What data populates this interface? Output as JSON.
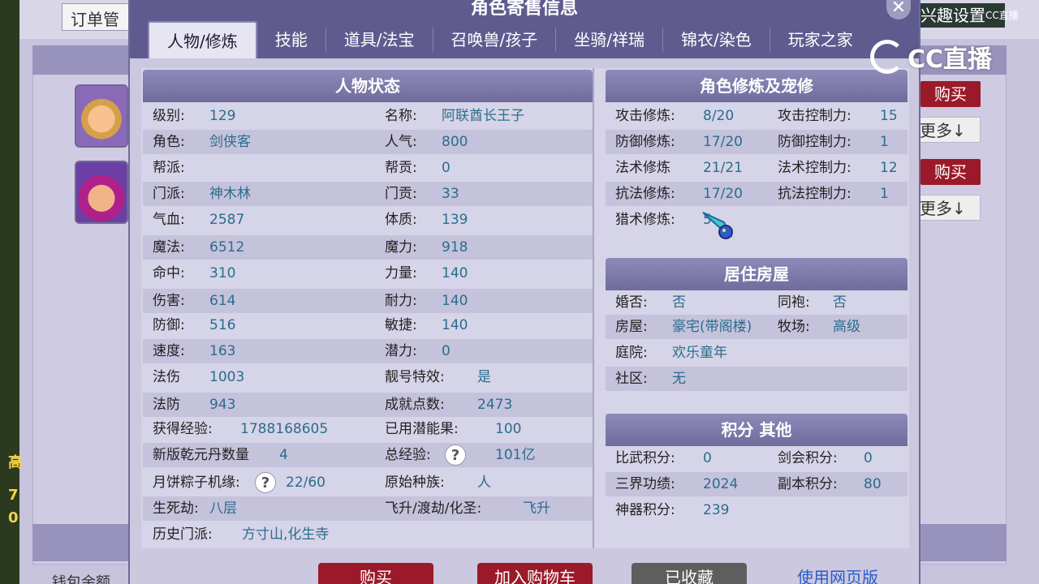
{
  "background": {
    "order_field": "订单管",
    "interest": "兴趣设置",
    "buy_label": "购买",
    "more_label": "更多↓",
    "balance": "钱包余额",
    "left_glyphs": [
      "高",
      "7",
      "0"
    ]
  },
  "watermark": {
    "brand": "CC直播",
    "small": "CC直播"
  },
  "dialog": {
    "title": "角色寄售信息",
    "close": "✕",
    "tabs": [
      "人物/修炼",
      "技能",
      "道具/法宝",
      "召唤兽/孩子",
      "坐骑/祥瑞",
      "锦衣/染色",
      "玩家之家"
    ],
    "active_tab": 0
  },
  "status": {
    "header": "人物状态",
    "left": [
      {
        "label": "级别:",
        "value": "129"
      },
      {
        "label": "角色:",
        "value": "剑侠客"
      },
      {
        "label": "帮派:",
        "value": ""
      },
      {
        "label": "门派:",
        "value": "神木林"
      },
      {
        "label": "气血:",
        "value": "2587"
      },
      {
        "label": "魔法:",
        "value": "6512"
      },
      {
        "label": "命中:",
        "value": "310"
      },
      {
        "label": "伤害:",
        "value": "614"
      },
      {
        "label": "防御:",
        "value": "516"
      },
      {
        "label": "速度:",
        "value": "163"
      },
      {
        "label": "法伤",
        "value": "1003"
      },
      {
        "label": "法防",
        "value": "943"
      },
      {
        "label": "获得经验:",
        "value": "1788168605"
      },
      {
        "label": "新版乾元丹数量",
        "value": "4"
      },
      {
        "label": "月饼粽子机缘:",
        "value": "22/60",
        "help": "?"
      },
      {
        "label": "生死劫:",
        "value": "八层"
      },
      {
        "label": "历史门派:",
        "value": "方寸山,化生寺"
      }
    ],
    "right": [
      {
        "label": "名称:",
        "value": "阿联酋长王子"
      },
      {
        "label": "人气:",
        "value": "800"
      },
      {
        "label": "帮贡:",
        "value": "0"
      },
      {
        "label": "门贡:",
        "value": "33"
      },
      {
        "label": "体质:",
        "value": "139"
      },
      {
        "label": "魔力:",
        "value": "918"
      },
      {
        "label": "力量:",
        "value": "140"
      },
      {
        "label": "耐力:",
        "value": "140"
      },
      {
        "label": "敏捷:",
        "value": "140"
      },
      {
        "label": "潜力:",
        "value": "0"
      },
      {
        "label": "靓号特效:",
        "value": "是"
      },
      {
        "label": "成就点数:",
        "value": "2473"
      },
      {
        "label": "已用潜能果:",
        "value": "100"
      },
      {
        "label": "总经验:",
        "value": "101亿",
        "help": "?"
      },
      {
        "label": "原始种族:",
        "value": "人"
      },
      {
        "label": "飞升/渡劫/化圣:",
        "value": "飞升"
      }
    ]
  },
  "cultivation": {
    "header": "角色修炼及宠修",
    "rows": [
      {
        "l1": "攻击修炼:",
        "v1": "8/20",
        "l2": "攻击控制力:",
        "v2": "15"
      },
      {
        "l1": "防御修炼:",
        "v1": "17/20",
        "l2": "防御控制力:",
        "v2": "1"
      },
      {
        "l1": "法术修炼",
        "v1": "21/21",
        "l2": "法术控制力:",
        "v2": "12"
      },
      {
        "l1": "抗法修炼:",
        "v1": "17/20",
        "l2": "抗法控制力:",
        "v2": "1"
      },
      {
        "l1": "猎术修炼:",
        "v1": "5",
        "l2": "",
        "v2": ""
      }
    ]
  },
  "house": {
    "header": "居住房屋",
    "rows": [
      {
        "l1": "婚否:",
        "v1": "否",
        "l2": "同袍:",
        "v2": "否"
      },
      {
        "l1": "房屋:",
        "v1": "豪宅(带阁楼)",
        "l2": "牧场:",
        "v2": "高级"
      },
      {
        "l1": "庭院:",
        "v1": "欢乐童年",
        "l2": "",
        "v2": ""
      },
      {
        "l1": "社区:",
        "v1": "无",
        "l2": "",
        "v2": ""
      }
    ]
  },
  "points": {
    "header": "积分 其他",
    "rows": [
      {
        "l1": "比武积分:",
        "v1": "0",
        "l2": "剑会积分:",
        "v2": "0"
      },
      {
        "l1": "三界功绩:",
        "v1": "2024",
        "l2": "副本积分:",
        "v2": "80"
      },
      {
        "l1": "神器积分:",
        "v1": "239",
        "l2": "",
        "v2": ""
      }
    ]
  },
  "footer": {
    "buy": "购买",
    "add_cart": "加入购物车",
    "favorited": "已收藏",
    "web_version": "使用网页版"
  }
}
